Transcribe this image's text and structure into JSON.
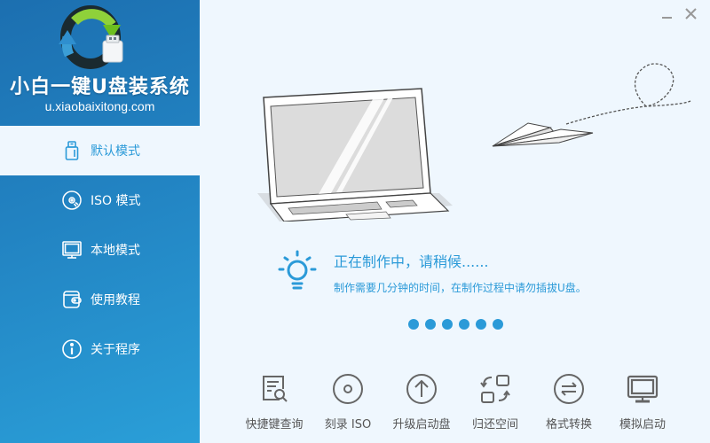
{
  "app": {
    "title": "小白一键U盘装系统",
    "url": "u.xiaobaixitong.com"
  },
  "window_controls": {
    "minimize": "minimize-icon",
    "close": "close-icon"
  },
  "sidebar": {
    "items": [
      {
        "label": "默认模式",
        "icon": "usb-drive-icon",
        "active": true
      },
      {
        "label": "ISO 模式",
        "icon": "disc-icon",
        "active": false
      },
      {
        "label": "本地模式",
        "icon": "monitor-icon",
        "active": false
      },
      {
        "label": "使用教程",
        "icon": "wallet-icon",
        "active": false
      },
      {
        "label": "关于程序",
        "icon": "info-icon",
        "active": false
      }
    ]
  },
  "status": {
    "title": "正在制作中，请稍候......",
    "description": "制作需要几分钟的时间，在制作过程中请勿插拔U盘。",
    "dots_count": 6
  },
  "toolbar": {
    "items": [
      {
        "label": "快捷键查询",
        "icon": "document-search-icon"
      },
      {
        "label": "刻录 ISO",
        "icon": "disc-icon"
      },
      {
        "label": "升级启动盘",
        "icon": "arrow-up-circle-icon"
      },
      {
        "label": "归还空间",
        "icon": "swap-squares-icon"
      },
      {
        "label": "格式转换",
        "icon": "convert-arrows-icon"
      },
      {
        "label": "模拟启动",
        "icon": "monitor-icon"
      }
    ]
  },
  "colors": {
    "accent": "#2b9ad8",
    "sidebar_top": "#1c6fb0",
    "sidebar_bottom": "#2a9fd8",
    "background": "#eff7fe",
    "tool_text": "#555555"
  }
}
